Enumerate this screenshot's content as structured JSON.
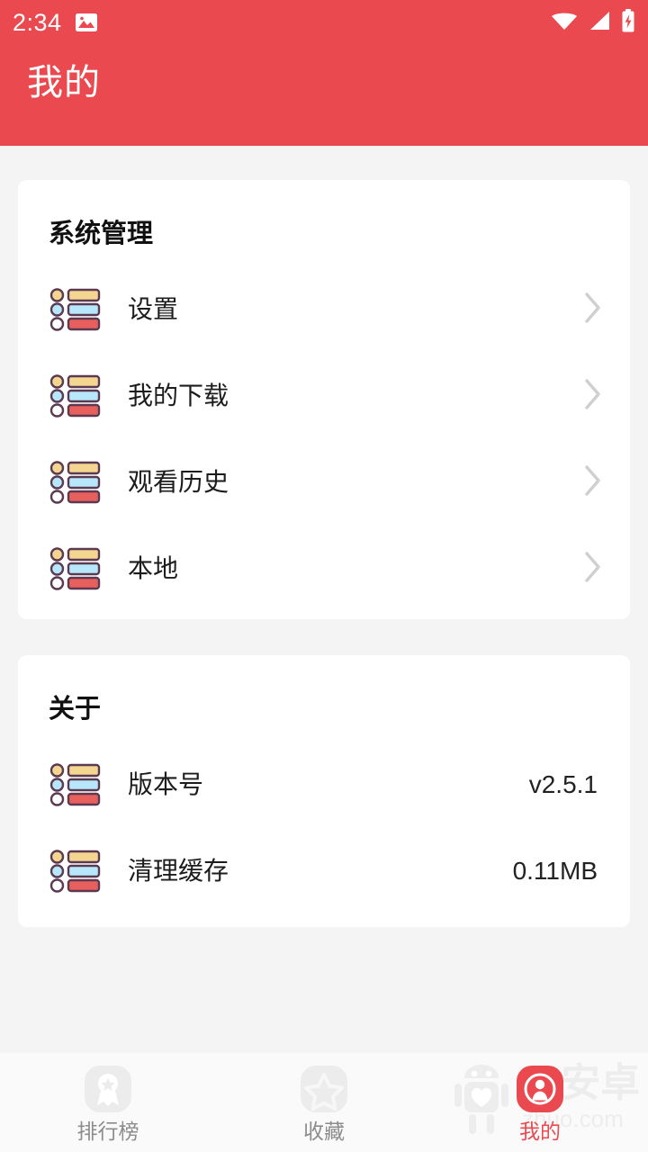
{
  "theme": {
    "accent": "#ea4a4f",
    "page_bg": "#f4f4f4",
    "card_bg": "#ffffff",
    "navbar_bg": "#fafafa",
    "icon_row1": "#f3d68f",
    "icon_row2": "#b7e7fa",
    "icon_row3": "#e8605e",
    "icon_outline": "#5b3a52",
    "chevron": "#cfcfcf",
    "muted_text": "#8c8c8c"
  },
  "statusbar": {
    "time": "2:34",
    "icons": [
      "photo-icon",
      "wifi-icon",
      "signal-icon",
      "battery-charging-icon"
    ]
  },
  "header": {
    "title": "我的"
  },
  "sections": [
    {
      "id": "system",
      "title": "系统管理",
      "rows": [
        {
          "label": "设置",
          "icon": "list-icon",
          "accessory": "chevron-right-icon",
          "value": ""
        },
        {
          "label": "我的下载",
          "icon": "list-icon",
          "accessory": "chevron-right-icon",
          "value": ""
        },
        {
          "label": "观看历史",
          "icon": "list-icon",
          "accessory": "chevron-right-icon",
          "value": ""
        },
        {
          "label": "本地",
          "icon": "list-icon",
          "accessory": "chevron-right-icon",
          "value": ""
        }
      ]
    },
    {
      "id": "about",
      "title": "关于",
      "rows": [
        {
          "label": "版本号",
          "icon": "list-icon",
          "accessory": "value",
          "value": "v2.5.1"
        },
        {
          "label": "清理缓存",
          "icon": "list-icon",
          "accessory": "value",
          "value": "0.11MB"
        }
      ]
    }
  ],
  "bottom_nav": [
    {
      "label": "排行榜",
      "icon": "medal-icon",
      "active": false
    },
    {
      "label": "收藏",
      "icon": "star-icon",
      "active": false
    },
    {
      "label": "我的",
      "icon": "person-icon",
      "active": true
    }
  ],
  "watermark": {
    "text": "99安卓",
    "subtext": "zhuo.com"
  }
}
